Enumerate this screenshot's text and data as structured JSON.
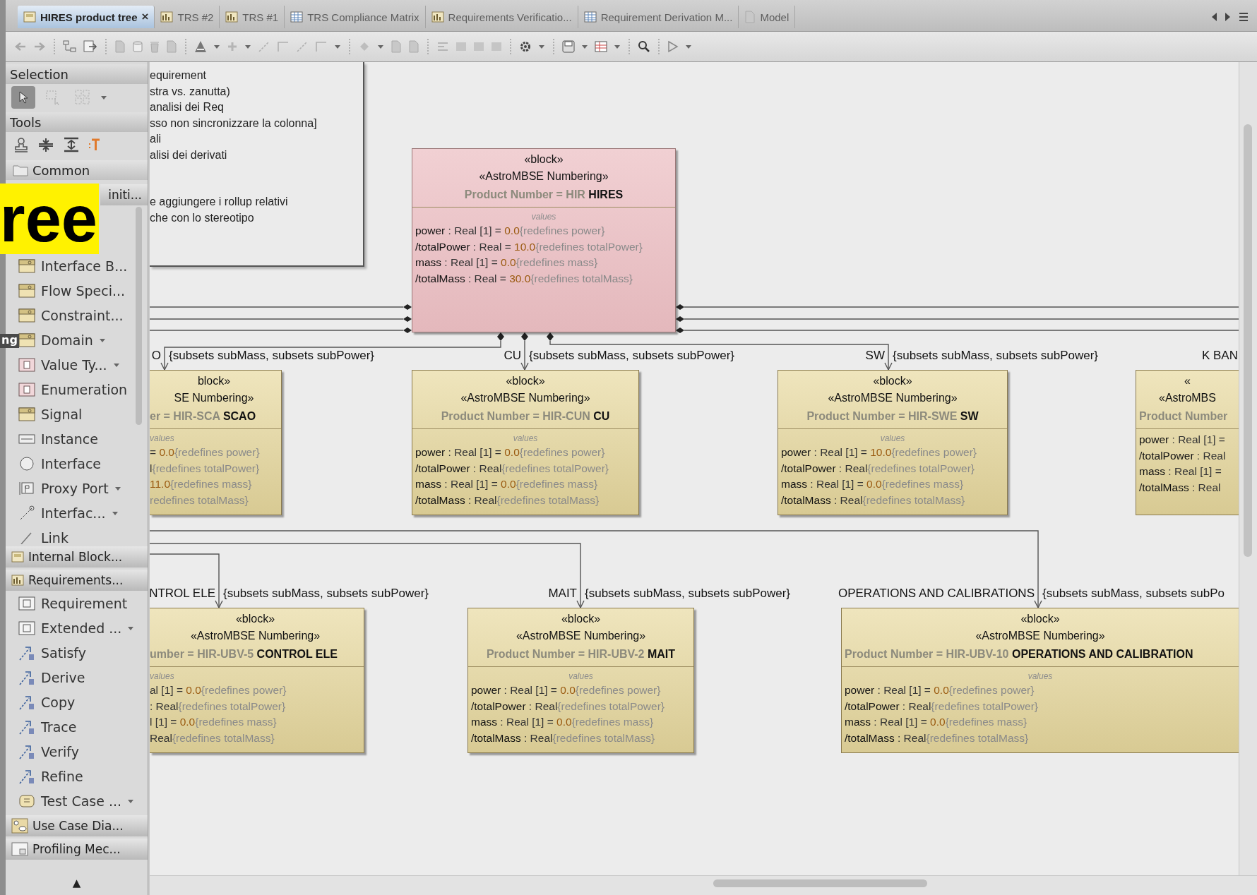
{
  "tabs": [
    {
      "label": "HIRES product tree",
      "selected": true,
      "close": "×"
    },
    {
      "label": "TRS #2",
      "selected": false
    },
    {
      "label": "TRS #1",
      "selected": false
    },
    {
      "label": "TRS Compliance Matrix",
      "selected": false
    },
    {
      "label": "Requirements Verificatio...",
      "selected": false
    },
    {
      "label": "Requirement Derivation M...",
      "selected": false
    },
    {
      "label": "Model",
      "selected": false
    }
  ],
  "palette": {
    "rows": [
      {
        "kind": "header",
        "text": "Selection"
      },
      {
        "kind": "tools",
        "tools": [
          {
            "selected": true
          },
          {
            "selected": false
          },
          {
            "selected": false
          }
        ]
      },
      {
        "kind": "header",
        "text": "Tools"
      },
      {
        "kind": "icons"
      },
      {
        "kind": "folder",
        "text": "Common"
      },
      {
        "kind": "group",
        "text": "initi...",
        "covered": true
      },
      {
        "kind": "list",
        "items": [
          {
            "text": "Interface B...",
            "menu": false
          },
          {
            "text": "Flow Speci...",
            "menu": false
          },
          {
            "text": "Constraint...",
            "menu": false
          },
          {
            "text": "Domain",
            "menu": true
          },
          {
            "text": "Value Ty...",
            "menu": true
          },
          {
            "text": "Enumeration",
            "menu": false
          },
          {
            "text": "Signal",
            "menu": false
          },
          {
            "text": "Instance",
            "menu": false
          },
          {
            "text": "Interface",
            "menu": false
          },
          {
            "text": "Proxy Port",
            "menu": true
          },
          {
            "text": "Interfac...",
            "menu": true
          },
          {
            "text": "Link",
            "menu": false
          }
        ]
      },
      {
        "kind": "group",
        "text": "Internal Block...",
        "covered": false
      },
      {
        "kind": "group",
        "text": "Requirements...",
        "covered": false
      },
      {
        "kind": "list",
        "items": [
          {
            "text": "Requirement",
            "menu": false
          },
          {
            "text": "Extended ...",
            "menu": true
          },
          {
            "text": "Satisfy",
            "menu": false
          },
          {
            "text": "Derive",
            "menu": false
          },
          {
            "text": "Copy",
            "menu": false
          },
          {
            "text": "Trace",
            "menu": false
          },
          {
            "text": "Verify",
            "menu": false
          },
          {
            "text": "Refine",
            "menu": false
          },
          {
            "text": "Test Case ...",
            "menu": true
          }
        ]
      },
      {
        "kind": "group",
        "text": "Use Case Dia...",
        "covered": false
      },
      {
        "kind": "group",
        "text": "Profiling Mec...",
        "covered": false
      },
      {
        "kind": "scroll",
        "text": "▲"
      }
    ]
  },
  "note": {
    "paragraphs": [
      [
        "equirement",
        "stra vs. zanutta)",
        "analisi dei Req",
        "sso non sincronizzare la colonna]",
        "ali",
        "alisi dei derivati"
      ],
      [
        "e aggiungere i rollup relativi",
        "che con lo stereotipo"
      ]
    ]
  },
  "blocks": [
    {
      "kind": "root",
      "stereotypes": [
        "«block»",
        "«AstroMBSE Numbering»"
      ],
      "product_number": "Product Number = HIR **HIRES**",
      "compartment": "values",
      "properties": [
        {
          "name": "power",
          "type": ": Real [1] =",
          "value": "0.0",
          "constraint": "{redefines power}"
        },
        {
          "name": "/totalPower",
          "type": ": Real =",
          "value": "10.0",
          "constraint": "{redefines totalPower}"
        },
        {
          "name": "mass",
          "type": ": Real [1] =",
          "value": "0.0",
          "constraint": "{redefines mass}"
        },
        {
          "name": "/totalMass",
          "type": ": Real =",
          "value": "30.0",
          "constraint": "{redefines totalMass}"
        }
      ]
    },
    {
      "kind": "part",
      "role": "O",
      "constraint": "{subsets subMass, subsets subPower}",
      "stereotypes": [
        "block»",
        "SE Numbering»"
      ],
      "product_number": "er = HIR-SCA **SCAO**",
      "compartment": "values",
      "properties": [
        {
          "type": "=",
          "value": "0.0",
          "constraint": "{redefines power}"
        },
        {
          "type": "l",
          "constraint": "{redefines totalPower}"
        },
        {
          "value": "11.0",
          "constraint": "{redefines mass}"
        },
        {
          "constraint": "redefines totalMass}"
        }
      ]
    },
    {
      "kind": "part",
      "role": "CU",
      "constraint": "{subsets subMass, subsets subPower}",
      "stereotypes": [
        "«block»",
        "«AstroMBSE Numbering»"
      ],
      "product_number": "Product Number = HIR-CUN **CU**",
      "compartment": "values",
      "properties": [
        {
          "name": "power",
          "type": ": Real [1] =",
          "value": "0.0",
          "constraint": "{redefines power}"
        },
        {
          "name": "/totalPower",
          "type": ": Real",
          "constraint": "{redefines totalPower}"
        },
        {
          "name": "mass",
          "type": ": Real [1] =",
          "value": "0.0",
          "constraint": "{redefines mass}"
        },
        {
          "name": "/totalMass",
          "type": ": Real",
          "constraint": "{redefines totalMass}"
        }
      ]
    },
    {
      "kind": "part",
      "role": "SW",
      "constraint": "{subsets subMass, subsets subPower}",
      "stereotypes": [
        "«block»",
        "«AstroMBSE Numbering»"
      ],
      "product_number": "Product Number = HIR-SWE **SW**",
      "compartment": "values",
      "properties": [
        {
          "name": "power",
          "type": ": Real [1] =",
          "value": "10.0",
          "constraint": "{redefines power}"
        },
        {
          "name": "/totalPower",
          "type": ": Real",
          "constraint": "{redefines totalPower}"
        },
        {
          "name": "mass",
          "type": ": Real [1] =",
          "value": "0.0",
          "constraint": "{redefines mass}"
        },
        {
          "name": "/totalMass",
          "type": ": Real",
          "constraint": "{redefines totalMass}"
        }
      ]
    },
    {
      "kind": "part",
      "role": "K BAN",
      "stereotypes": [
        "«",
        "«AstroMBS"
      ],
      "product_number": "Product Number",
      "properties": [
        {
          "name": "power",
          "type": ": Real [1] ="
        },
        {
          "name": "/totalPower",
          "type": ": Real"
        },
        {
          "name": "mass",
          "type": ": Real [1] ="
        },
        {
          "name": "/totalMass",
          "type": ": Real"
        }
      ]
    },
    {
      "kind": "part",
      "role": "NTROL ELE",
      "constraint": "{subsets subMass, subsets subPower}",
      "stereotypes": [
        "«block»",
        "«AstroMBSE Numbering»"
      ],
      "product_number": "umber = HIR-UBV-5 **CONTROL ELE**",
      "compartment": "values",
      "properties": [
        {
          "type": "al [1] =",
          "value": "0.0",
          "constraint": "{redefines power}"
        },
        {
          "type": ": Real",
          "constraint": "{redefines totalPower}"
        },
        {
          "type": "l [1] =",
          "value": "0.0",
          "constraint": "{redefines mass}"
        },
        {
          "type": "Real",
          "constraint": "{redefines totalMass}"
        }
      ]
    },
    {
      "kind": "part",
      "role": "MAIT",
      "constraint": "{subsets subMass, subsets subPower}",
      "stereotypes": [
        "«block»",
        "«AstroMBSE Numbering»"
      ],
      "product_number": "Product Number = HIR-UBV-2 **MAIT**",
      "compartment": "values",
      "properties": [
        {
          "name": "power",
          "type": ": Real [1] =",
          "value": "0.0",
          "constraint": "{redefines power}"
        },
        {
          "name": "/totalPower",
          "type": ": Real",
          "constraint": "{redefines totalPower}"
        },
        {
          "name": "mass",
          "type": ": Real [1] =",
          "value": "0.0",
          "constraint": "{redefines mass}"
        },
        {
          "name": "/totalMass",
          "type": ": Real",
          "constraint": "{redefines totalMass}"
        }
      ]
    },
    {
      "kind": "part",
      "role": "OPERATIONS AND CALIBRATIONS",
      "constraint": "{subsets subMass, subsets subPo",
      "stereotypes": [
        "«block»",
        "«AstroMBSE Numbering»"
      ],
      "product_number": "Product Number = HIR-UBV-10 **OPERATIONS AND CALIBRATION**",
      "compartment": "values",
      "properties": [
        {
          "name": "power",
          "type": ": Real [1] =",
          "value": "0.0",
          "constraint": "{redefines power}"
        },
        {
          "name": "/totalPower",
          "type": ": Real",
          "constraint": "{redefines totalPower}"
        },
        {
          "name": "mass",
          "type": ": Real [1] =",
          "value": "0.0",
          "constraint": "{redefines mass}"
        },
        {
          "name": "/totalMass",
          "type": ": Real",
          "constraint": "{redefines totalMass}"
        }
      ]
    }
  ],
  "overlay": {
    "title_fragment": "ree",
    "caption_fragment": "ng"
  }
}
